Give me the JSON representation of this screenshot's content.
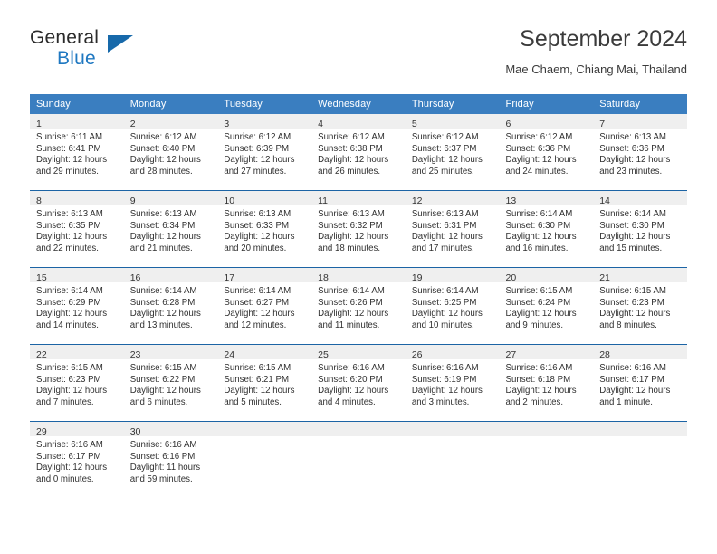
{
  "brand": {
    "name_part1": "General",
    "name_part2": "Blue",
    "triangle_color": "#1769aa"
  },
  "header": {
    "month_title": "September 2024",
    "location": "Mae Chaem, Chiang Mai, Thailand"
  },
  "colors": {
    "header_blue": "#3a7ec0",
    "row_divider": "#1c64a5",
    "daynum_band": "#efefef",
    "brand_blue": "#1f78c1"
  },
  "weekday_headers": [
    "Sunday",
    "Monday",
    "Tuesday",
    "Wednesday",
    "Thursday",
    "Friday",
    "Saturday"
  ],
  "weeks": [
    [
      {
        "day": "1",
        "sunrise": "Sunrise: 6:11 AM",
        "sunset": "Sunset: 6:41 PM",
        "daylight_line1": "Daylight: 12 hours",
        "daylight_line2": "and 29 minutes."
      },
      {
        "day": "2",
        "sunrise": "Sunrise: 6:12 AM",
        "sunset": "Sunset: 6:40 PM",
        "daylight_line1": "Daylight: 12 hours",
        "daylight_line2": "and 28 minutes."
      },
      {
        "day": "3",
        "sunrise": "Sunrise: 6:12 AM",
        "sunset": "Sunset: 6:39 PM",
        "daylight_line1": "Daylight: 12 hours",
        "daylight_line2": "and 27 minutes."
      },
      {
        "day": "4",
        "sunrise": "Sunrise: 6:12 AM",
        "sunset": "Sunset: 6:38 PM",
        "daylight_line1": "Daylight: 12 hours",
        "daylight_line2": "and 26 minutes."
      },
      {
        "day": "5",
        "sunrise": "Sunrise: 6:12 AM",
        "sunset": "Sunset: 6:37 PM",
        "daylight_line1": "Daylight: 12 hours",
        "daylight_line2": "and 25 minutes."
      },
      {
        "day": "6",
        "sunrise": "Sunrise: 6:12 AM",
        "sunset": "Sunset: 6:36 PM",
        "daylight_line1": "Daylight: 12 hours",
        "daylight_line2": "and 24 minutes."
      },
      {
        "day": "7",
        "sunrise": "Sunrise: 6:13 AM",
        "sunset": "Sunset: 6:36 PM",
        "daylight_line1": "Daylight: 12 hours",
        "daylight_line2": "and 23 minutes."
      }
    ],
    [
      {
        "day": "8",
        "sunrise": "Sunrise: 6:13 AM",
        "sunset": "Sunset: 6:35 PM",
        "daylight_line1": "Daylight: 12 hours",
        "daylight_line2": "and 22 minutes."
      },
      {
        "day": "9",
        "sunrise": "Sunrise: 6:13 AM",
        "sunset": "Sunset: 6:34 PM",
        "daylight_line1": "Daylight: 12 hours",
        "daylight_line2": "and 21 minutes."
      },
      {
        "day": "10",
        "sunrise": "Sunrise: 6:13 AM",
        "sunset": "Sunset: 6:33 PM",
        "daylight_line1": "Daylight: 12 hours",
        "daylight_line2": "and 20 minutes."
      },
      {
        "day": "11",
        "sunrise": "Sunrise: 6:13 AM",
        "sunset": "Sunset: 6:32 PM",
        "daylight_line1": "Daylight: 12 hours",
        "daylight_line2": "and 18 minutes."
      },
      {
        "day": "12",
        "sunrise": "Sunrise: 6:13 AM",
        "sunset": "Sunset: 6:31 PM",
        "daylight_line1": "Daylight: 12 hours",
        "daylight_line2": "and 17 minutes."
      },
      {
        "day": "13",
        "sunrise": "Sunrise: 6:14 AM",
        "sunset": "Sunset: 6:30 PM",
        "daylight_line1": "Daylight: 12 hours",
        "daylight_line2": "and 16 minutes."
      },
      {
        "day": "14",
        "sunrise": "Sunrise: 6:14 AM",
        "sunset": "Sunset: 6:30 PM",
        "daylight_line1": "Daylight: 12 hours",
        "daylight_line2": "and 15 minutes."
      }
    ],
    [
      {
        "day": "15",
        "sunrise": "Sunrise: 6:14 AM",
        "sunset": "Sunset: 6:29 PM",
        "daylight_line1": "Daylight: 12 hours",
        "daylight_line2": "and 14 minutes."
      },
      {
        "day": "16",
        "sunrise": "Sunrise: 6:14 AM",
        "sunset": "Sunset: 6:28 PM",
        "daylight_line1": "Daylight: 12 hours",
        "daylight_line2": "and 13 minutes."
      },
      {
        "day": "17",
        "sunrise": "Sunrise: 6:14 AM",
        "sunset": "Sunset: 6:27 PM",
        "daylight_line1": "Daylight: 12 hours",
        "daylight_line2": "and 12 minutes."
      },
      {
        "day": "18",
        "sunrise": "Sunrise: 6:14 AM",
        "sunset": "Sunset: 6:26 PM",
        "daylight_line1": "Daylight: 12 hours",
        "daylight_line2": "and 11 minutes."
      },
      {
        "day": "19",
        "sunrise": "Sunrise: 6:14 AM",
        "sunset": "Sunset: 6:25 PM",
        "daylight_line1": "Daylight: 12 hours",
        "daylight_line2": "and 10 minutes."
      },
      {
        "day": "20",
        "sunrise": "Sunrise: 6:15 AM",
        "sunset": "Sunset: 6:24 PM",
        "daylight_line1": "Daylight: 12 hours",
        "daylight_line2": "and 9 minutes."
      },
      {
        "day": "21",
        "sunrise": "Sunrise: 6:15 AM",
        "sunset": "Sunset: 6:23 PM",
        "daylight_line1": "Daylight: 12 hours",
        "daylight_line2": "and 8 minutes."
      }
    ],
    [
      {
        "day": "22",
        "sunrise": "Sunrise: 6:15 AM",
        "sunset": "Sunset: 6:23 PM",
        "daylight_line1": "Daylight: 12 hours",
        "daylight_line2": "and 7 minutes."
      },
      {
        "day": "23",
        "sunrise": "Sunrise: 6:15 AM",
        "sunset": "Sunset: 6:22 PM",
        "daylight_line1": "Daylight: 12 hours",
        "daylight_line2": "and 6 minutes."
      },
      {
        "day": "24",
        "sunrise": "Sunrise: 6:15 AM",
        "sunset": "Sunset: 6:21 PM",
        "daylight_line1": "Daylight: 12 hours",
        "daylight_line2": "and 5 minutes."
      },
      {
        "day": "25",
        "sunrise": "Sunrise: 6:16 AM",
        "sunset": "Sunset: 6:20 PM",
        "daylight_line1": "Daylight: 12 hours",
        "daylight_line2": "and 4 minutes."
      },
      {
        "day": "26",
        "sunrise": "Sunrise: 6:16 AM",
        "sunset": "Sunset: 6:19 PM",
        "daylight_line1": "Daylight: 12 hours",
        "daylight_line2": "and 3 minutes."
      },
      {
        "day": "27",
        "sunrise": "Sunrise: 6:16 AM",
        "sunset": "Sunset: 6:18 PM",
        "daylight_line1": "Daylight: 12 hours",
        "daylight_line2": "and 2 minutes."
      },
      {
        "day": "28",
        "sunrise": "Sunrise: 6:16 AM",
        "sunset": "Sunset: 6:17 PM",
        "daylight_line1": "Daylight: 12 hours",
        "daylight_line2": "and 1 minute."
      }
    ],
    [
      {
        "day": "29",
        "sunrise": "Sunrise: 6:16 AM",
        "sunset": "Sunset: 6:17 PM",
        "daylight_line1": "Daylight: 12 hours",
        "daylight_line2": "and 0 minutes."
      },
      {
        "day": "30",
        "sunrise": "Sunrise: 6:16 AM",
        "sunset": "Sunset: 6:16 PM",
        "daylight_line1": "Daylight: 11 hours",
        "daylight_line2": "and 59 minutes."
      },
      {
        "day": "",
        "sunrise": "",
        "sunset": "",
        "daylight_line1": "",
        "daylight_line2": ""
      },
      {
        "day": "",
        "sunrise": "",
        "sunset": "",
        "daylight_line1": "",
        "daylight_line2": ""
      },
      {
        "day": "",
        "sunrise": "",
        "sunset": "",
        "daylight_line1": "",
        "daylight_line2": ""
      },
      {
        "day": "",
        "sunrise": "",
        "sunset": "",
        "daylight_line1": "",
        "daylight_line2": ""
      },
      {
        "day": "",
        "sunrise": "",
        "sunset": "",
        "daylight_line1": "",
        "daylight_line2": ""
      }
    ]
  ]
}
